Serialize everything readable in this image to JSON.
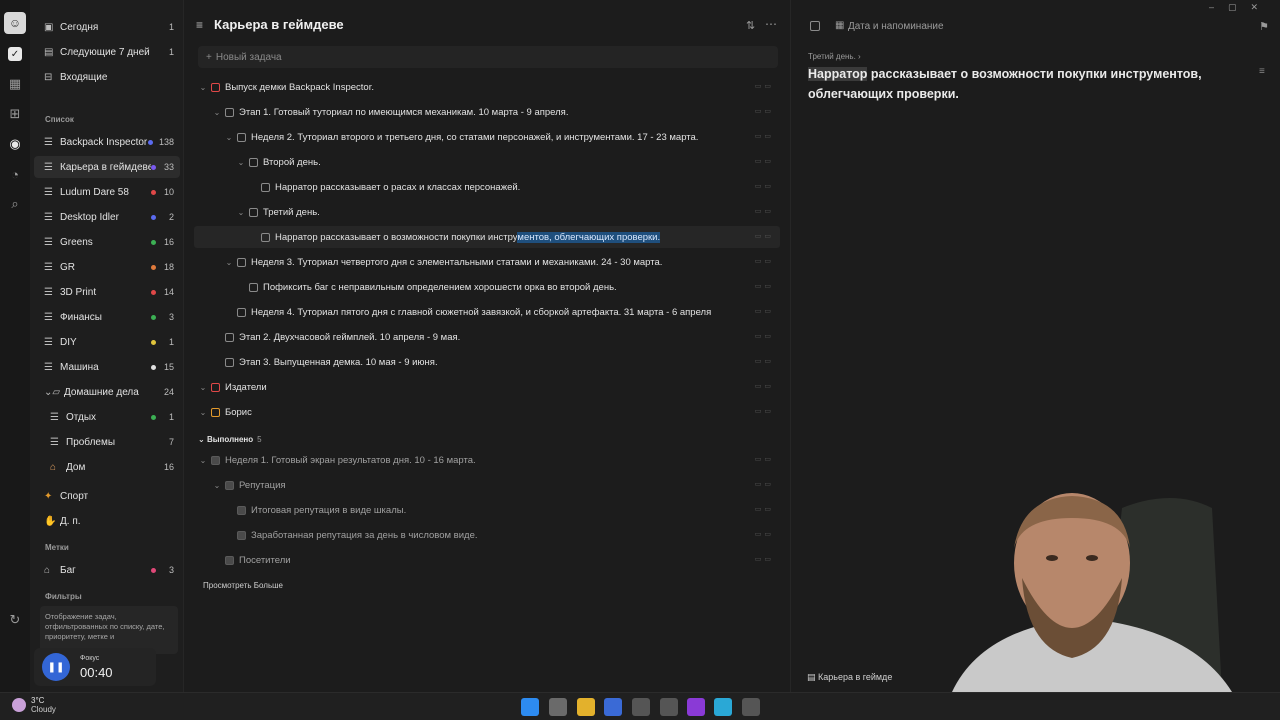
{
  "sidebar": {
    "smart_lists": [
      {
        "label": "Сегодня",
        "count": "1",
        "icon": "calendar-today-icon"
      },
      {
        "label": "Следующие 7 дней",
        "count": "1",
        "icon": "calendar-week-icon"
      },
      {
        "label": "Входящие",
        "count": "",
        "icon": "inbox-icon"
      }
    ],
    "lists_section": "Список",
    "lists": [
      {
        "label": "Backpack Inspector",
        "count": "138",
        "dot": "#5b6bf0"
      },
      {
        "label": "Карьера в геймдеве",
        "count": "33",
        "dot": "#7a5af0",
        "active": true
      },
      {
        "label": "Ludum Dare 58",
        "count": "10",
        "dot": "#e04848"
      },
      {
        "label": "Desktop Idler",
        "count": "2",
        "dot": "#5b6bf0"
      },
      {
        "label": "Greens",
        "count": "16",
        "dot": "#3cb054"
      },
      {
        "label": "GR",
        "count": "18",
        "dot": "#e07a3c"
      },
      {
        "label": "3D Print",
        "count": "14",
        "dot": "#e04848"
      },
      {
        "label": "Финансы",
        "count": "3",
        "dot": "#3cb054"
      },
      {
        "label": "DIY",
        "count": "1",
        "dot": "#e0c43c"
      },
      {
        "label": "Машина",
        "count": "15",
        "dot": "#e0e0e0"
      }
    ],
    "folder": {
      "label": "Домашние дела",
      "count": "24"
    },
    "folder_children": [
      {
        "label": "Отдых",
        "count": "1",
        "dot": "#3cb054"
      },
      {
        "label": "Проблемы",
        "count": "7",
        "dot": ""
      },
      {
        "label": "Дом",
        "count": "16",
        "dot": ""
      }
    ],
    "extra_lists": [
      {
        "label": "Спорт",
        "count": ""
      },
      {
        "label": "Д. п.",
        "count": ""
      }
    ],
    "tags_section": "Метки",
    "tags": [
      {
        "label": "Баг",
        "count": "3",
        "dot": "#e04878"
      }
    ],
    "filters_section": "Фильтры",
    "filters_note": "Отображение задач, отфильтрованных по списку, дате, приоритету, метке и",
    "focus_label": "Фокус",
    "focus_time": "00:40"
  },
  "main": {
    "title": "Карьера в геймдеве",
    "new_task_placeholder": "Новый задача",
    "tasks": [
      {
        "text": "Выпуск демки Backpack Inspector.",
        "color": "red"
      },
      {
        "text": "Этап 1. Готовый туториал по имеющимся механикам. 10 марта - 9 апреля."
      },
      {
        "text": "Неделя 2. Туториал второго и третьего дня, со статами персонажей, и инструментами. 17 - 23 марта."
      },
      {
        "text": "Второй день."
      },
      {
        "text": "Нарратор рассказывает о расах и классах персонажей."
      },
      {
        "text": "Третий день."
      },
      {
        "text_before": "Нарратор рассказывает о возможности покупки инстру",
        "text_selected": "ментов, облегчающих проверки."
      },
      {
        "text": "Неделя 3. Туториал четвертого дня с элементальными статами и механиками. 24 - 30 марта."
      },
      {
        "text": "Пофиксить баг с неправильным определением хорошести орка во второй день."
      },
      {
        "text": "Неделя 4. Туториал пятого дня с главной сюжетной завязкой, и сборкой артефакта. 31 марта - 6 апреля"
      },
      {
        "text": "Этап 2. Двухчасовой геймплей. 10 апреля - 9 мая."
      },
      {
        "text": "Этап 3. Выпущенная демка. 10 мая - 9 июня."
      },
      {
        "text": "Издатели",
        "color": "red"
      },
      {
        "text": "Борис",
        "color": "orange"
      }
    ],
    "completed_label": "Выполнено",
    "completed_count": "5",
    "completed_tasks": [
      {
        "text": "Неделя 1. Готовый экран результатов дня. 10 - 16 марта."
      },
      {
        "text": "Репутация"
      },
      {
        "text": "Итоговая репутация в виде шкалы."
      },
      {
        "text": "Заработанная репутация за день в числовом виде."
      },
      {
        "text": "Посетители"
      }
    ],
    "see_more": "Просмотреть Больше"
  },
  "detail": {
    "date_label": "Дата и напоминание",
    "breadcrumb": "Третий день.",
    "title_highlight": "Нарратор",
    "title_rest": " рассказывает о возможности покупки инструментов, облегчающих проверки.",
    "project": "Карьера в геймдеве"
  },
  "taskbar": {
    "temp": "3°C",
    "condition": "Cloudy"
  }
}
